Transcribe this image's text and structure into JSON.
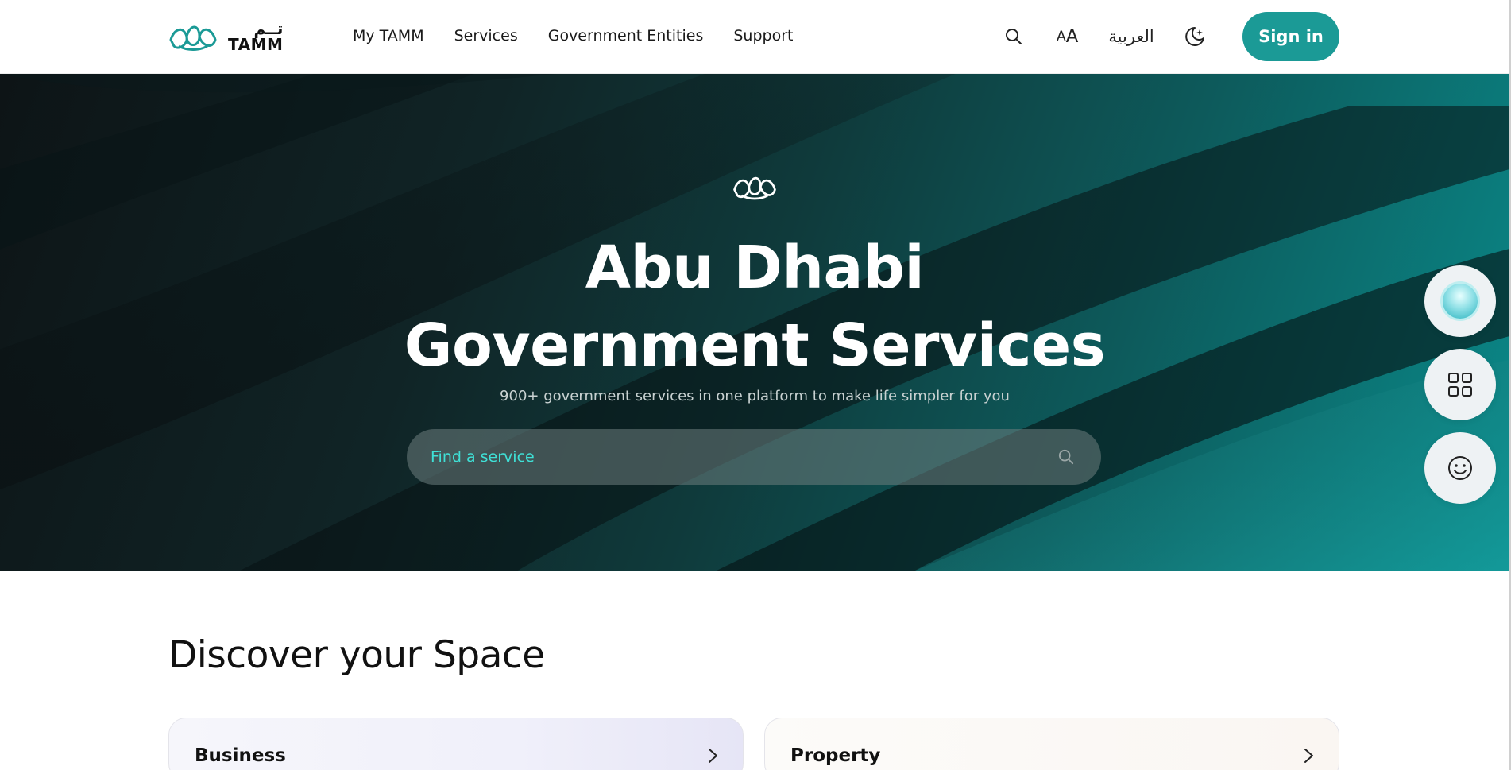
{
  "header": {
    "logo_arabic": "تــم",
    "logo_english": "TAMM",
    "nav": [
      {
        "label": "My TAMM"
      },
      {
        "label": "Services"
      },
      {
        "label": "Government Entities"
      },
      {
        "label": "Support"
      }
    ],
    "font_size_small": "A",
    "font_size_big": "A",
    "language_label": "العربية",
    "sign_in_label": "Sign in"
  },
  "hero": {
    "title_line1": "Abu Dhabi",
    "title_line2": "Government Services",
    "subtitle": "900+ government services in one platform to make life simpler for you",
    "search_placeholder": "Find a service"
  },
  "discover": {
    "title": "Discover your Space",
    "cards": [
      {
        "label": "Business"
      },
      {
        "label": "Property"
      }
    ]
  },
  "icons": {
    "search": "search-icon",
    "theme": "moon-icon",
    "apps": "grid-icon",
    "feedback": "smiley-icon",
    "assistant": "assistant-orb-icon",
    "arrow": "chevron-right-icon"
  },
  "colors": {
    "accent": "#1b9a96",
    "search_text": "#3fe0d6"
  }
}
